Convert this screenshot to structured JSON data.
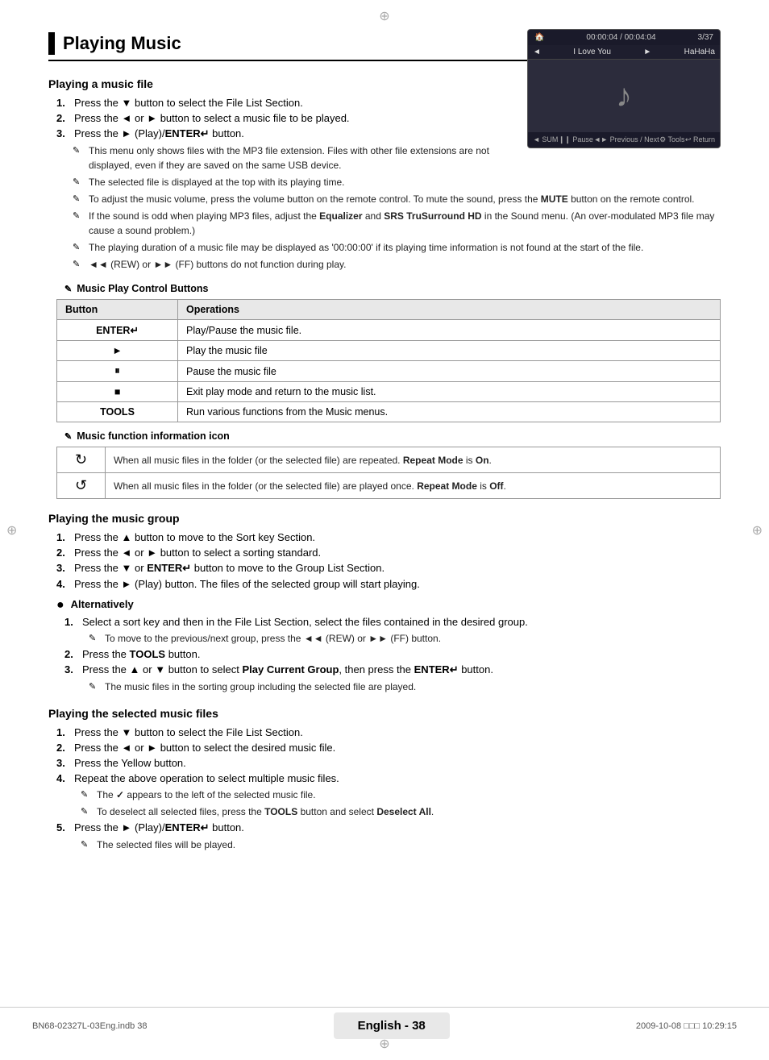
{
  "page": {
    "title": "Playing Music",
    "crosshair_top": "⊕",
    "crosshair_left": "⊕",
    "crosshair_right": "⊕",
    "crosshair_bottom": "⊕"
  },
  "section_playing_file": {
    "title": "Playing a music file",
    "steps": [
      {
        "num": "1.",
        "text": "Press the ▼ button to select the File List Section."
      },
      {
        "num": "2.",
        "text": "Press the ◄ or ► button to select a music file to be played."
      },
      {
        "num": "3.",
        "text": "Press the ► (Play)/ENTER↵ button."
      }
    ],
    "notes": [
      "This menu only shows files with the MP3 file extension. Files with other file extensions are not displayed, even if they are saved on the same USB device.",
      "The selected file is displayed at the top with its playing time.",
      "To adjust the music volume, press the volume button on the remote control. To mute the sound, press the MUTE button on the remote control.",
      "If the sound is odd when playing MP3 files, adjust the Equalizer and SRS TruSurround HD in the Sound menu. (An over-modulated MP3 file may cause a sound problem.)",
      "The playing duration of a music file may be displayed as '00:00:00' if its playing time information is not found at the start of the file.",
      "◄◄ (REW) or ►► (FF) buttons do not function during play."
    ]
  },
  "table_music_control": {
    "header": "Music Play Control Buttons",
    "col_button": "Button",
    "col_operations": "Operations",
    "rows": [
      {
        "button": "ENTER↵",
        "operation": "Play/Pause the music file."
      },
      {
        "button": "►",
        "operation": "Play the music file"
      },
      {
        "button": "⏸",
        "operation": "Pause the music file"
      },
      {
        "button": "■",
        "operation": "Exit play mode and return to the music list."
      },
      {
        "button": "TOOLS",
        "operation": "Run various functions from the Music menus."
      }
    ]
  },
  "table_music_icon": {
    "header": "Music function information icon",
    "rows": [
      {
        "icon": "↻",
        "text": "When all music files in the folder (or the selected file) are repeated. Repeat Mode is On."
      },
      {
        "icon": "↺",
        "text": "When all music files in the folder (or the selected file) are played once. Repeat Mode is Off."
      }
    ]
  },
  "section_playing_group": {
    "title": "Playing the music group",
    "steps": [
      {
        "num": "1.",
        "text": "Press the ▲ button to move to the Sort key Section."
      },
      {
        "num": "2.",
        "text": "Press the ◄ or ► button to select a sorting standard."
      },
      {
        "num": "3.",
        "text": "Press the ▼ or ENTER↵ button to move to the Group List Section."
      },
      {
        "num": "4.",
        "text": "Press the ► (Play) button. The files of the selected group will start playing."
      }
    ],
    "alternatively_label": "Alternatively",
    "alt_step1": "Select a sort key and then in the File List Section, select the files contained in the desired group.",
    "alt_note1": "To move to the previous/next group, press the ◄◄ (REW) or ►► (FF) button.",
    "alt_step2": "Press the TOOLS button.",
    "alt_step3": "Press the ▲ or ▼ button to select Play Current Group, then press the ENTER↵ button.",
    "alt_note2": "The music files in the sorting group including the selected file are played."
  },
  "section_playing_selected": {
    "title": "Playing the selected music files",
    "steps": [
      {
        "num": "1.",
        "text": "Press the ▼ button to select the File List Section."
      },
      {
        "num": "2.",
        "text": "Press the ◄ or ► button to select the desired music file."
      },
      {
        "num": "3.",
        "text": "Press the Yellow button."
      },
      {
        "num": "4.",
        "text": "Repeat the above operation to select multiple music files."
      },
      {
        "num": "5.",
        "text": "Press the ► (Play)/ENTER↵ button."
      }
    ],
    "notes_step4": [
      "The ✓ appears to the left of the selected music file.",
      "To deselect all selected files, press the TOOLS button and select Deselect All."
    ],
    "note_step5": "The selected files will be played."
  },
  "screenshot": {
    "topbar_icon": "🏠",
    "topbar_time": "00:00:04 / 00:04:04",
    "topbar_page": "3/37",
    "songbar_prev": "◄",
    "songbar_title": "I Love You",
    "songbar_next": "►",
    "songbar_artist": "HaHaHa",
    "bottom_sum": "◄ SUM",
    "bottom_pause": "❙❙ Pause",
    "bottom_prev_next": "◄► Previous / Next",
    "bottom_tools": "⚙ Tools",
    "bottom_return": "↩ Return"
  },
  "footer": {
    "file_info": "BN68-02327L-03Eng.indb   38",
    "page_label": "English - 38",
    "date_info": "2009-10-08   □□□  10:29:15"
  }
}
